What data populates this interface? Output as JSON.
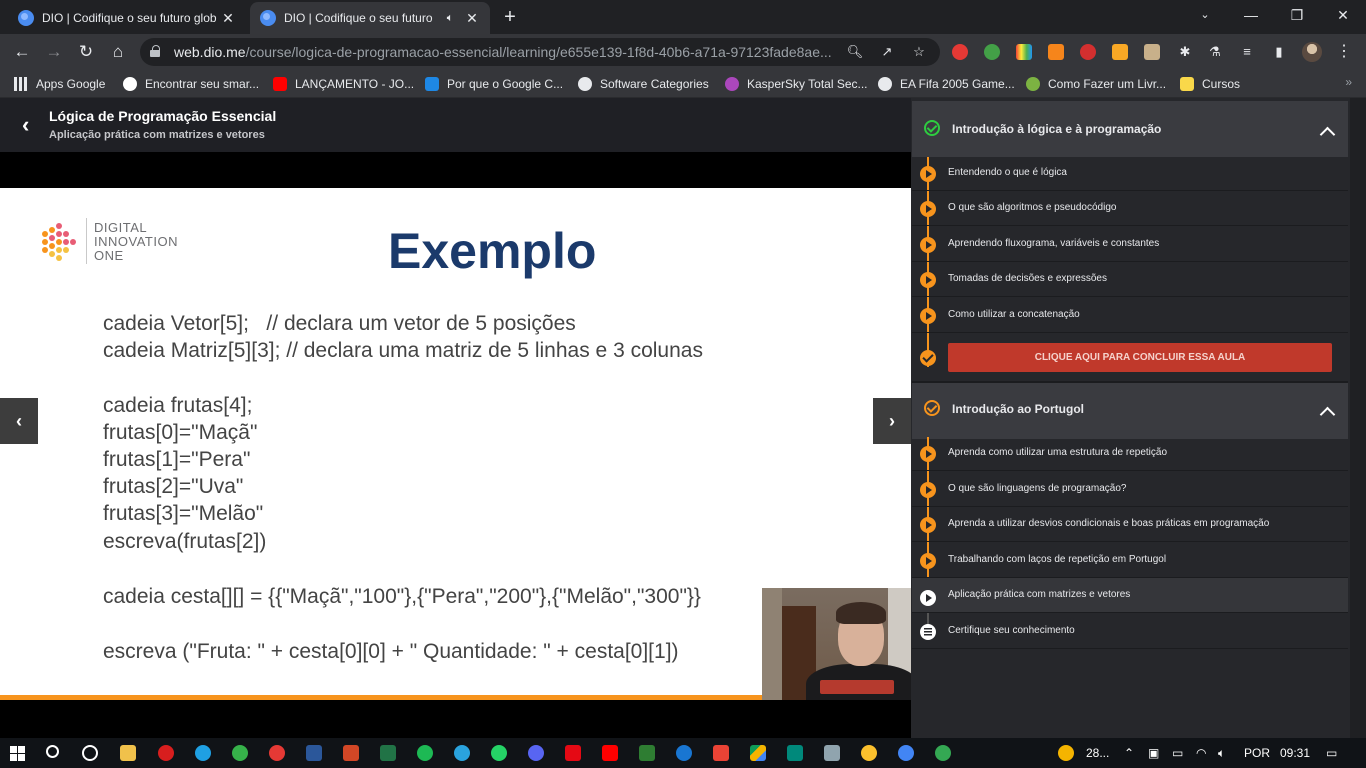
{
  "browser": {
    "tabs": [
      {
        "title": "DIO | Codifique o seu futuro glob",
        "active": false
      },
      {
        "title": "DIO | Codifique o seu futuro",
        "active": true
      }
    ],
    "url_host": "web.dio.me",
    "url_path": "/course/logica-de-programacao-essencial/learning/e655e139-1f8d-40b6-a71a-97123fade8ae...",
    "bookmarks": [
      "Apps Google",
      "Encontrar seu smar...",
      "LANÇAMENTO - JO...",
      "Por que o Google C...",
      "Software Categories",
      "KasperSky Total Sec...",
      "EA Fifa 2005 Game...",
      "Como Fazer um Livr...",
      "Cursos"
    ],
    "bookmarks_more": "»"
  },
  "course": {
    "title": "Lógica de Programação Essencial",
    "subtitle": "Aplicação prática com matrizes e vetores"
  },
  "slide": {
    "logo_lines": [
      "DIGITAL",
      "INNOVATION",
      "ONE"
    ],
    "title": "Exemplo",
    "code_lines": [
      "cadeia Vetor[5];   // declara um vetor de 5 posições",
      "cadeia Matriz[5][3]; // declara uma matriz de 5 linhas e 3 colunas",
      "cadeia frutas[4];",
      "frutas[0]=\"Maçã\"",
      "frutas[1]=\"Pera\"",
      "frutas[2]=\"Uva\"",
      "frutas[3]=\"Melão\"",
      "escreva(frutas[2])",
      "cadeia cesta[][] = {{\"Maçã\",\"100\"},{\"Pera\",\"200\"},{\"Melão\",\"300\"}}",
      "escreva (\"Fruta: \" + cesta[0][0] + \" Quantidade: \" + cesta[0][1])"
    ]
  },
  "sidebar": {
    "module1": {
      "title": "Introdução à lógica e à programação",
      "lessons": [
        "Entendendo o que é lógica",
        "O que são algoritmos e pseudocódigo",
        "Aprendendo fluxograma, variáveis e constantes",
        "Tomadas de decisões e expressões",
        "Como utilizar a concatenação"
      ],
      "cta": "CLIQUE AQUI PARA CONCLUIR ESSA AULA"
    },
    "module2": {
      "title": "Introdução ao Portugol",
      "lessons": [
        "Aprenda como utilizar uma estrutura de repetição",
        "O que são linguagens de programação?",
        "Aprenda a utilizar desvios condicionais e boas práticas em programação",
        "Trabalhando com laços de repetição em Portugol",
        "Aplicação prática com matrizes e vetores",
        "Certifique seu conhecimento"
      ]
    }
  },
  "taskbar": {
    "weather": "28...",
    "lang": "POR",
    "time": "09:31"
  },
  "colors": {
    "accent_orange": "#f7941d",
    "cta_red": "#c0392b",
    "check_green": "#2ecc40",
    "slide_title": "#1b3a6b"
  }
}
